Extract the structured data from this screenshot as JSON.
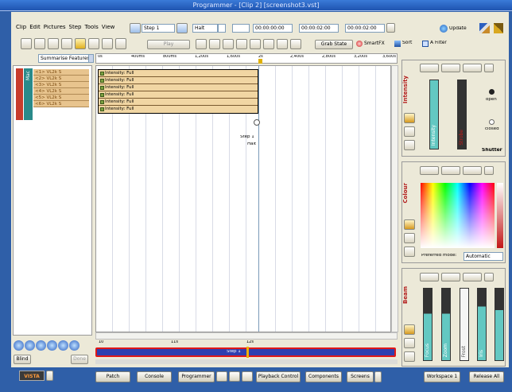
{
  "window": {
    "title": "Programmer - [Clip 2] [screenshot3.vst]"
  },
  "menu": [
    "Clip",
    "Edit",
    "Pictures",
    "Step",
    "Tools",
    "View"
  ],
  "toolbar1": {
    "step_value": "Step 1",
    "halt_value": "Halt",
    "time1": "00:00:00:00",
    "time2": "00:00:02:00",
    "time3": "00:00:02:00",
    "update_label": "Update"
  },
  "toolbar2": {
    "play_label": "Play",
    "grab_state_label": "Grab State",
    "smartfx_label": "SmartFX",
    "sort_label": "Sort",
    "afilter_label": "A Filter"
  },
  "summarise_select": "Summarise Features",
  "ruler_marks": [
    "0s",
    "400ms",
    "800ms",
    "1,200s",
    "1,600s",
    "2s",
    "2,400s",
    "2,800s",
    "3,200s",
    "3,600s"
  ],
  "fixtures": {
    "group_label": "Mac",
    "rows": [
      "<1> VL2k S",
      "<2> VL2k S",
      "<3> VL2k S",
      "<4> VL2k S",
      "<5> VL2k S",
      "<6> VL2k S"
    ]
  },
  "cue_rows": [
    "Intensity: Full",
    "Intensity: Full",
    "Intensity: Full",
    "Intensity: Full",
    "Intensity: Full",
    "Intensity: Full"
  ],
  "step_label": "Step 1",
  "halt_label": "Halt",
  "bottom": {
    "zoom_ruler": [
      "10",
      "11s",
      "12s"
    ],
    "timeline_step": "Step 1",
    "blind_label": "Blind",
    "done_label": "Done"
  },
  "intensity": {
    "header": "Intensity",
    "slider_label": "Intensity",
    "slider2_label": "Strobe",
    "open_label": "open",
    "closed_label": "closed",
    "shutter_label": "Shutter"
  },
  "colour": {
    "header": "Colour",
    "preferred_label": "Preferred mode:",
    "mode_value": "Automatic"
  },
  "beam": {
    "header": "Beam",
    "sliders": [
      "Focus",
      "Zoom",
      "Frost",
      "Iris",
      ""
    ]
  },
  "taskbar": {
    "logo": "VISTA",
    "buttons": [
      "Patch",
      "Console",
      "Programmer",
      "Playback Control",
      "Components",
      "Screens"
    ],
    "workspace": "Workspace 1",
    "release": "Release All"
  },
  "colors": {
    "accent": "#2f5fa8",
    "cue_fill": "#f1d6a3",
    "slider_teal": "#63c8c2",
    "slider_red": "#c21818"
  }
}
